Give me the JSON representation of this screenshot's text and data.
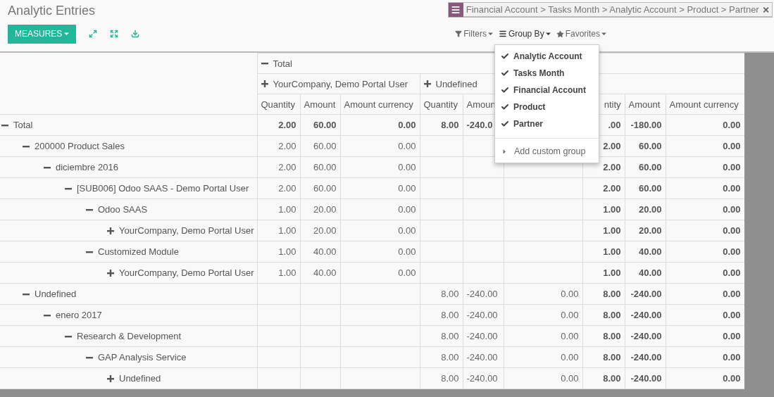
{
  "title": "Analytic Entries",
  "toolbar": {
    "measures_button": "MEASURES"
  },
  "search": {
    "facets": [
      "Financial Account > Tasks Month > Analytic Account > Product > Partner"
    ]
  },
  "search_menus": [
    {
      "label": "Filters",
      "kind": "filter",
      "open": false
    },
    {
      "label": "Group By",
      "kind": "group",
      "open": true
    },
    {
      "label": "Favorites",
      "kind": "favorite",
      "open": false
    }
  ],
  "group_by_menu": {
    "items": [
      {
        "label": "Analytic Account",
        "checked": true
      },
      {
        "label": "Tasks Month",
        "checked": true
      },
      {
        "label": "Financial Account",
        "checked": true
      },
      {
        "label": "Product",
        "checked": true
      },
      {
        "label": "Partner",
        "checked": true
      }
    ],
    "custom": "Add custom group"
  },
  "column_headers": {
    "top": {
      "label": "Total",
      "expanded": true
    },
    "groups": [
      {
        "label": "YourCompany, Demo Portal User",
        "expanded": false,
        "measures": {
          "quantity": "Quantity",
          "amount": "Amount",
          "amount_currency": "Amount currency"
        }
      },
      {
        "label": "Undefined",
        "expanded": false,
        "measures": {
          "quantity": "Quantity",
          "amount": "Amoun"
        }
      }
    ],
    "total_measures": {
      "quantity": "ntity",
      "amount": "Amount",
      "amount_currency": "Amount currency"
    }
  },
  "rows": [
    {
      "label": "Total",
      "expanded": true,
      "group_1": {
        "quantity": "2.00",
        "amount": "60.00",
        "amount_currency": "0.00"
      },
      "group_2": {
        "quantity": "8.00",
        "amount": "-240.0"
      },
      "total": {
        "quantity": ".00",
        "amount": "-180.00",
        "amount_currency": "0.00"
      },
      "children": [
        {
          "label": "200000 Product Sales",
          "expanded": true,
          "group_1": {
            "quantity": "2.00",
            "amount": "60.00",
            "amount_currency": "0.00"
          },
          "total": {
            "quantity": "2.00",
            "amount": "60.00",
            "amount_currency": "0.00"
          },
          "children": [
            {
              "label": "diciembre 2016",
              "expanded": true,
              "group_1": {
                "quantity": "2.00",
                "amount": "60.00",
                "amount_currency": "0.00"
              },
              "total": {
                "quantity": "2.00",
                "amount": "60.00",
                "amount_currency": "0.00"
              },
              "children": [
                {
                  "label": "[SUB006] Odoo SAAS - Demo Portal User",
                  "expanded": true,
                  "group_1": {
                    "quantity": "2.00",
                    "amount": "60.00",
                    "amount_currency": "0.00"
                  },
                  "total": {
                    "quantity": "2.00",
                    "amount": "60.00",
                    "amount_currency": "0.00"
                  },
                  "children": [
                    {
                      "label": "Odoo SAAS",
                      "expanded": true,
                      "group_1": {
                        "quantity": "1.00",
                        "amount": "20.00",
                        "amount_currency": "0.00"
                      },
                      "total": {
                        "quantity": "1.00",
                        "amount": "20.00",
                        "amount_currency": "0.00"
                      },
                      "children": [
                        {
                          "label": "YourCompany, Demo Portal User",
                          "expanded": false,
                          "group_1": {
                            "quantity": "1.00",
                            "amount": "20.00",
                            "amount_currency": "0.00"
                          },
                          "total": {
                            "quantity": "1.00",
                            "amount": "20.00",
                            "amount_currency": "0.00"
                          }
                        }
                      ]
                    },
                    {
                      "label": "Customized Module",
                      "expanded": true,
                      "group_1": {
                        "quantity": "1.00",
                        "amount": "40.00",
                        "amount_currency": "0.00"
                      },
                      "total": {
                        "quantity": "1.00",
                        "amount": "40.00",
                        "amount_currency": "0.00"
                      },
                      "children": [
                        {
                          "label": "YourCompany, Demo Portal User",
                          "expanded": false,
                          "group_1": {
                            "quantity": "1.00",
                            "amount": "40.00",
                            "amount_currency": "0.00"
                          },
                          "total": {
                            "quantity": "1.00",
                            "amount": "40.00",
                            "amount_currency": "0.00"
                          }
                        }
                      ]
                    }
                  ]
                }
              ]
            }
          ]
        },
        {
          "label": "Undefined",
          "expanded": true,
          "group_2": {
            "quantity": "8.00",
            "amount": "-240.00",
            "amount_currency": "0.00"
          },
          "total": {
            "quantity": "8.00",
            "amount": "-240.00",
            "amount_currency": "0.00"
          },
          "children": [
            {
              "label": "enero 2017",
              "expanded": true,
              "group_2": {
                "quantity": "8.00",
                "amount": "-240.00",
                "amount_currency": "0.00"
              },
              "total": {
                "quantity": "8.00",
                "amount": "-240.00",
                "amount_currency": "0.00"
              },
              "children": [
                {
                  "label": "Research & Development",
                  "expanded": true,
                  "group_2": {
                    "quantity": "8.00",
                    "amount": "-240.00",
                    "amount_currency": "0.00"
                  },
                  "total": {
                    "quantity": "8.00",
                    "amount": "-240.00",
                    "amount_currency": "0.00"
                  },
                  "children": [
                    {
                      "label": "GAP Analysis Service",
                      "expanded": true,
                      "group_2": {
                        "quantity": "8.00",
                        "amount": "-240.00",
                        "amount_currency": "0.00"
                      },
                      "total": {
                        "quantity": "8.00",
                        "amount": "-240.00",
                        "amount_currency": "0.00"
                      },
                      "children": [
                        {
                          "label": "Undefined",
                          "expanded": false,
                          "group_2": {
                            "quantity": "8.00",
                            "amount": "-240.00",
                            "amount_currency": "0.00"
                          },
                          "total": {
                            "quantity": "8.00",
                            "amount": "-240.00",
                            "amount_currency": "0.00"
                          }
                        }
                      ]
                    }
                  ]
                }
              ]
            }
          ]
        }
      ]
    }
  ]
}
